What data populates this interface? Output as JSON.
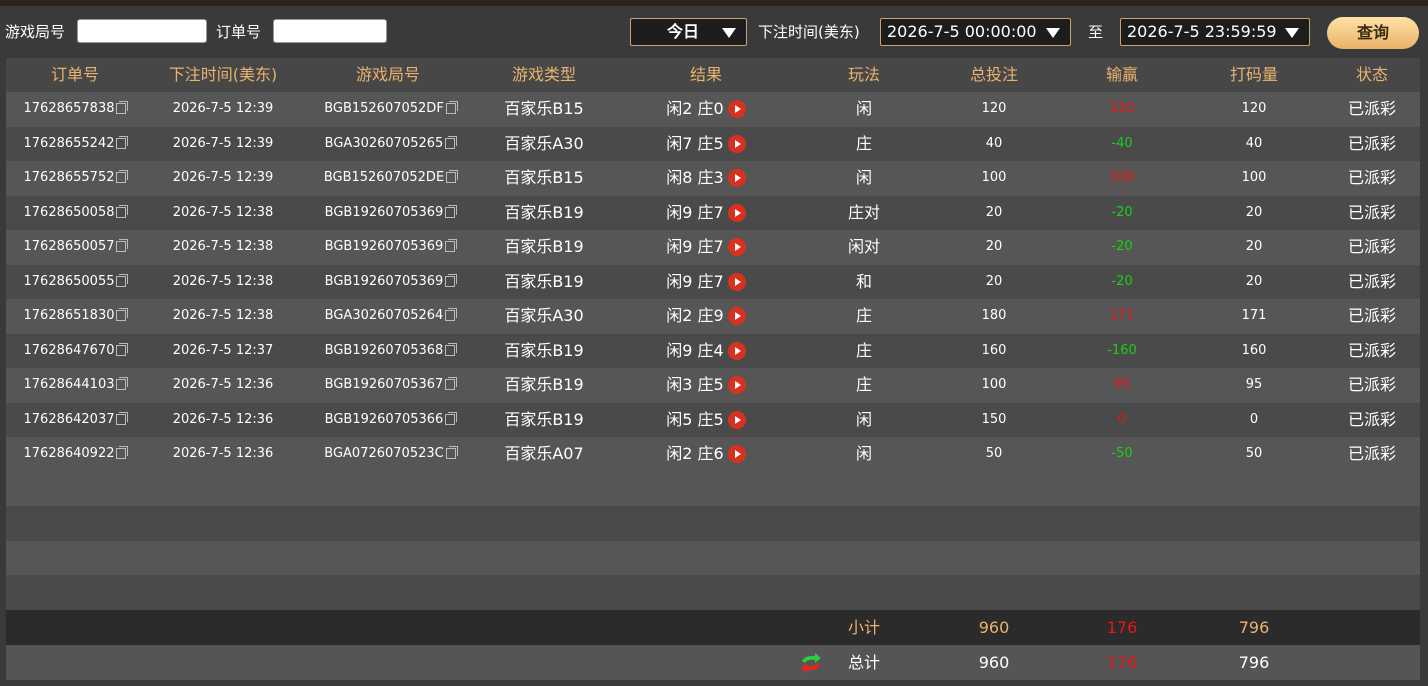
{
  "filters": {
    "game_round_label": "游戏局号",
    "game_round_value": "",
    "order_no_label": "订单号",
    "order_no_value": "",
    "period_select": "今日",
    "bet_time_label": "下注时间(美东)",
    "start_time": "2026-7-5 00:00:00",
    "to_label": "至",
    "end_time": "2026-7-5 23:59:59",
    "query_label": "查询"
  },
  "columns": [
    "订单号",
    "下注时间(美东)",
    "游戏局号",
    "游戏类型",
    "结果",
    "玩法",
    "总投注",
    "输赢",
    "打码量",
    "状态"
  ],
  "rows": [
    {
      "order": "17628657838",
      "time": "2026-7-5 12:39",
      "round": "BGB152607052DF",
      "game": "百家乐B15",
      "result": "闲2 庄0",
      "play": "闲",
      "bet": "120",
      "win": "120",
      "win_type": "pos",
      "valid": "120",
      "status": "已派彩"
    },
    {
      "order": "17628655242",
      "time": "2026-7-5 12:39",
      "round": "BGA30260705265",
      "game": "百家乐A30",
      "result": "闲7 庄5",
      "play": "庄",
      "bet": "40",
      "win": "-40",
      "win_type": "neg",
      "valid": "40",
      "status": "已派彩"
    },
    {
      "order": "17628655752",
      "time": "2026-7-5 12:39",
      "round": "BGB152607052DE",
      "game": "百家乐B15",
      "result": "闲8 庄3",
      "play": "闲",
      "bet": "100",
      "win": "100",
      "win_type": "pos",
      "valid": "100",
      "status": "已派彩"
    },
    {
      "order": "17628650058",
      "time": "2026-7-5 12:38",
      "round": "BGB19260705369",
      "game": "百家乐B19",
      "result": "闲9 庄7",
      "play": "庄对",
      "bet": "20",
      "win": "-20",
      "win_type": "neg",
      "valid": "20",
      "status": "已派彩"
    },
    {
      "order": "17628650057",
      "time": "2026-7-5 12:38",
      "round": "BGB19260705369",
      "game": "百家乐B19",
      "result": "闲9 庄7",
      "play": "闲对",
      "bet": "20",
      "win": "-20",
      "win_type": "neg",
      "valid": "20",
      "status": "已派彩"
    },
    {
      "order": "17628650055",
      "time": "2026-7-5 12:38",
      "round": "BGB19260705369",
      "game": "百家乐B19",
      "result": "闲9 庄7",
      "play": "和",
      "bet": "20",
      "win": "-20",
      "win_type": "neg",
      "valid": "20",
      "status": "已派彩"
    },
    {
      "order": "17628651830",
      "time": "2026-7-5 12:38",
      "round": "BGA30260705264",
      "game": "百家乐A30",
      "result": "闲2 庄9",
      "play": "庄",
      "bet": "180",
      "win": "171",
      "win_type": "pos",
      "valid": "171",
      "status": "已派彩"
    },
    {
      "order": "17628647670",
      "time": "2026-7-5 12:37",
      "round": "BGB19260705368",
      "game": "百家乐B19",
      "result": "闲9 庄4",
      "play": "庄",
      "bet": "160",
      "win": "-160",
      "win_type": "neg",
      "valid": "160",
      "status": "已派彩"
    },
    {
      "order": "17628644103",
      "time": "2026-7-5 12:36",
      "round": "BGB19260705367",
      "game": "百家乐B19",
      "result": "闲3 庄5",
      "play": "庄",
      "bet": "100",
      "win": "95",
      "win_type": "pos",
      "valid": "95",
      "status": "已派彩"
    },
    {
      "order": "17628642037",
      "time": "2026-7-5 12:36",
      "round": "BGB19260705366",
      "game": "百家乐B19",
      "result": "闲5 庄5",
      "play": "闲",
      "bet": "150",
      "win": "0",
      "win_type": "pos",
      "valid": "0",
      "status": "已派彩"
    },
    {
      "order": "17628640922",
      "time": "2026-7-5 12:36",
      "round": "BGA0726070523C",
      "game": "百家乐A07",
      "result": "闲2 庄6",
      "play": "闲",
      "bet": "50",
      "win": "-50",
      "win_type": "neg",
      "valid": "50",
      "status": "已派彩"
    }
  ],
  "subtotal": {
    "label": "小计",
    "bet": "960",
    "win": "176",
    "valid": "796"
  },
  "total": {
    "label": "总计",
    "bet": "960",
    "win": "176",
    "valid": "796"
  },
  "colors": {
    "header_text": "#e9b26e",
    "negative": "#18d018",
    "positive": "#e81515",
    "button": "#f0c27a"
  }
}
